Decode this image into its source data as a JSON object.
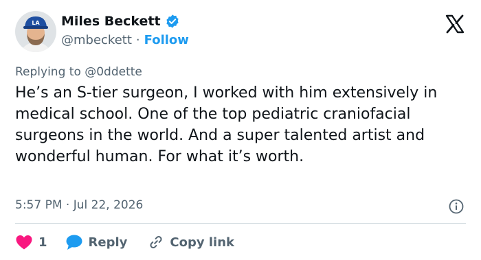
{
  "author": {
    "display_name": "Miles Beckett",
    "handle": "@mbeckett",
    "separator": "·",
    "follow_label": "Follow",
    "verified": true
  },
  "reply_context": "Replying to @0ddette",
  "tweet": {
    "text": "He’s an S-tier surgeon, I worked with him extensively in medical school. One of the top pediatric craniofacial surgeons in the world. And a super talented artist and wonderful human. For what it’s worth.",
    "timestamp": "5:57 PM · Jul 22, 2026"
  },
  "actions": {
    "like_count": "1",
    "reply_label": "Reply",
    "copy_link_label": "Copy link"
  },
  "icons": {
    "verified": "verified-badge-icon",
    "logo": "x-logo-icon",
    "info": "info-icon",
    "like": "heart-icon",
    "reply": "speech-bubble-icon",
    "copy": "link-icon"
  },
  "colors": {
    "accent": "#1d9bf0",
    "heart": "#f91880",
    "text": "#0f1419",
    "muted": "#536471",
    "divider": "#cfd9de"
  }
}
